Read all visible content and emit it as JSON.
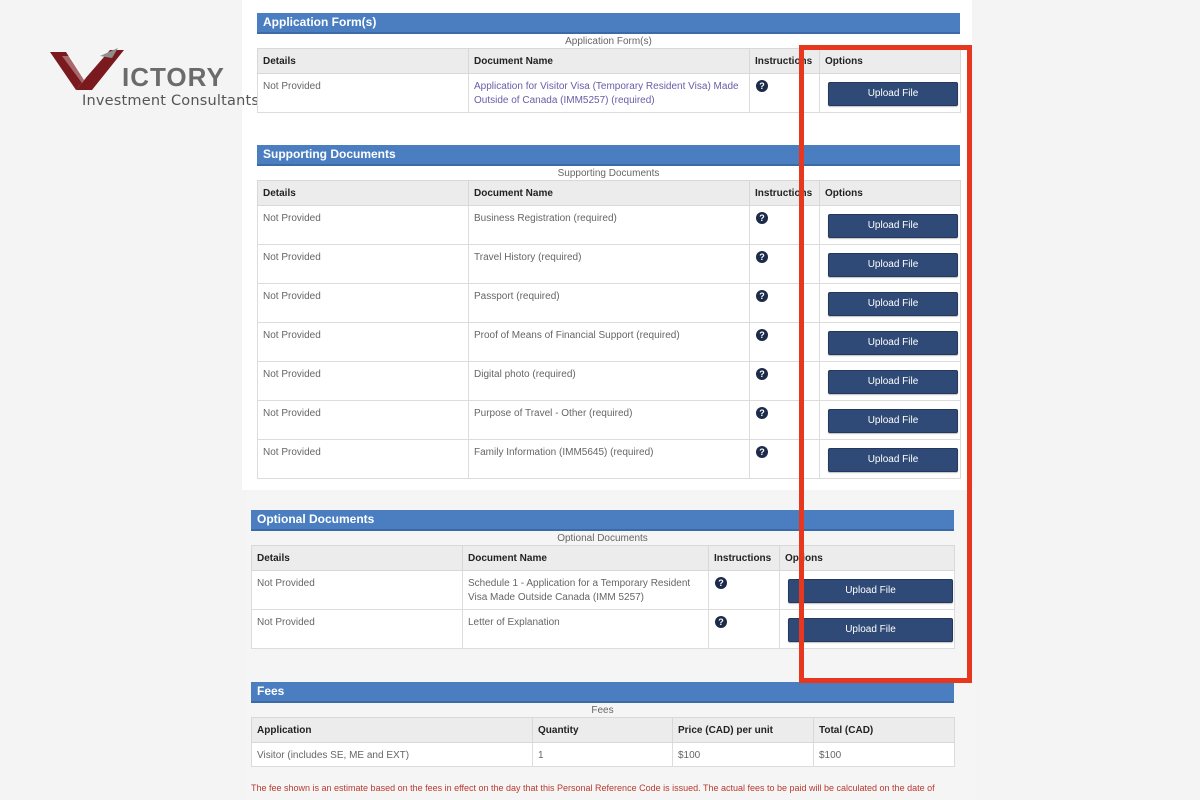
{
  "brand": {
    "logo_letter": "V",
    "name_dark": "ICTORY",
    "tagline": "Investment Consultants",
    "color_primary": "#7a1a1f",
    "color_secondary": "#6b6b6b"
  },
  "colors": {
    "section_header": "#4a7ec0",
    "button": "#2f4a76",
    "highlight": "#e8371f",
    "fee_note": "#b83a2e"
  },
  "application_forms": {
    "title": "Application Form(s)",
    "caption": "Application Form(s)",
    "columns": [
      "Details",
      "Document Name",
      "Instructions",
      "Options"
    ],
    "rows": [
      {
        "details": "Not Provided",
        "document": "Application for Visitor Visa (Temporary Resident Visa) Made Outside of Canada (IMM5257)  (required)",
        "button": "Upload File"
      }
    ]
  },
  "supporting_documents": {
    "title": "Supporting Documents",
    "caption": "Supporting Documents",
    "columns": [
      "Details",
      "Document Name",
      "Instructions",
      "Options"
    ],
    "rows": [
      {
        "details": "Not Provided",
        "document": "Business Registration  (required)",
        "button": "Upload File"
      },
      {
        "details": "Not Provided",
        "document": "Travel History  (required)",
        "button": "Upload File"
      },
      {
        "details": "Not Provided",
        "document": "Passport  (required)",
        "button": "Upload File"
      },
      {
        "details": "Not Provided",
        "document": "Proof of Means of Financial Support  (required)",
        "button": "Upload File"
      },
      {
        "details": "Not Provided",
        "document": "Digital photo  (required)",
        "button": "Upload File"
      },
      {
        "details": "Not Provided",
        "document": "Purpose of Travel - Other  (required)",
        "button": "Upload File"
      },
      {
        "details": "Not Provided",
        "document": "Family Information (IMM5645)  (required)",
        "button": "Upload File"
      }
    ]
  },
  "optional_documents": {
    "title": "Optional Documents",
    "caption": "Optional Documents",
    "columns": [
      "Details",
      "Document Name",
      "Instructions",
      "Options"
    ],
    "rows": [
      {
        "details": "Not Provided",
        "document": "Schedule 1 - Application for a Temporary Resident Visa Made Outside Canada (IMM 5257)",
        "button": "Upload File"
      },
      {
        "details": "Not Provided",
        "document": "Letter of Explanation",
        "button": "Upload File"
      }
    ]
  },
  "fees": {
    "title": "Fees",
    "caption": "Fees",
    "columns": [
      "Application",
      "Quantity",
      "Price (CAD) per unit",
      "Total (CAD)"
    ],
    "rows": [
      {
        "application": "Visitor (includes SE, ME and EXT)",
        "quantity": "1",
        "price": "$100",
        "total": "$100"
      }
    ],
    "note": "The fee shown is an estimate based on the fees in effect on the day that this Personal Reference Code is issued. The actual fees to be paid will be calculated on the date of"
  },
  "question_icon_glyph": "?"
}
